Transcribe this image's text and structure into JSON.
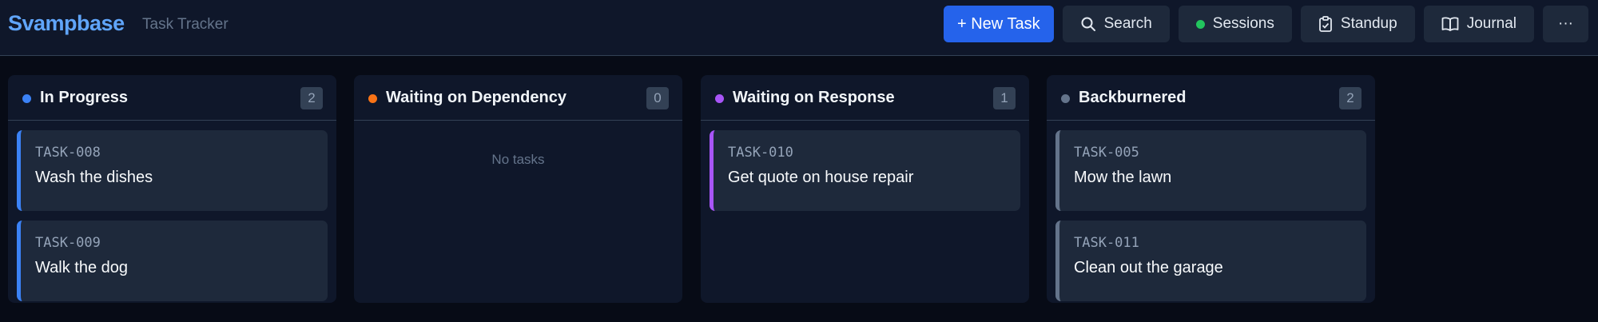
{
  "header": {
    "brand": "Svampbase",
    "subtitle": "Task Tracker",
    "actions": {
      "new_task": "+ New Task",
      "search": "Search",
      "sessions": "Sessions",
      "standup": "Standup",
      "journal": "Journal",
      "more": "···"
    }
  },
  "columns": [
    {
      "title": "In Progress",
      "count": "2",
      "dot_color": "#3b82f6",
      "cards": [
        {
          "id": "TASK-008",
          "title": "Wash the dishes"
        },
        {
          "id": "TASK-009",
          "title": "Walk the dog"
        }
      ]
    },
    {
      "title": "Waiting on Dependency",
      "count": "0",
      "dot_color": "#f97316",
      "empty_text": "No tasks",
      "cards": []
    },
    {
      "title": "Waiting on Response",
      "count": "1",
      "dot_color": "#a855f7",
      "cards": [
        {
          "id": "TASK-010",
          "title": "Get quote on house repair"
        }
      ]
    },
    {
      "title": "Backburnered",
      "count": "2",
      "dot_color": "#64748b",
      "cards": [
        {
          "id": "TASK-005",
          "title": "Mow the lawn"
        },
        {
          "id": "TASK-011",
          "title": "Clean out the garage"
        }
      ]
    }
  ]
}
